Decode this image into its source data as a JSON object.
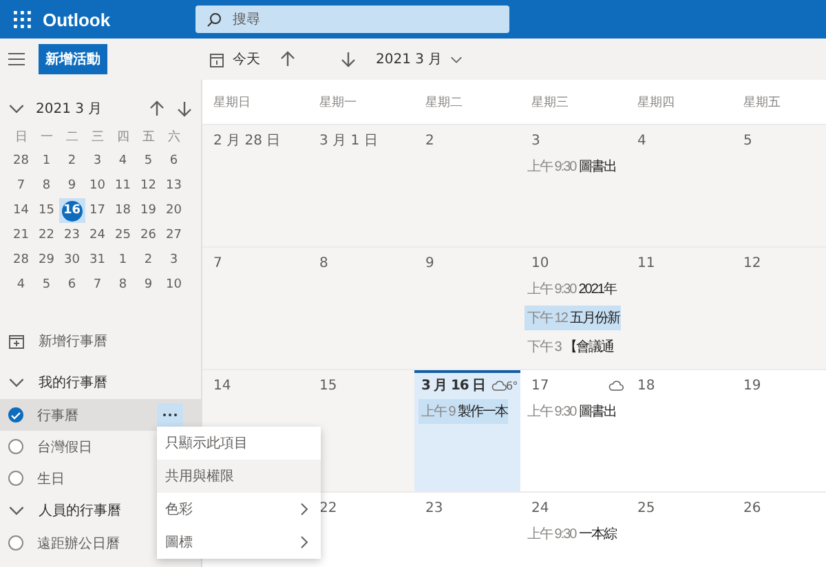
{
  "header": {
    "app_name": "Outlook",
    "search": {
      "placeholder": "搜尋"
    }
  },
  "toolbar": {
    "new_button": "新增活動",
    "today_button": "今天",
    "period": "2021 3 月"
  },
  "mini_calendar": {
    "title": "2021 3 月",
    "expanded": true,
    "weekdays": [
      "日",
      "一",
      "二",
      "三",
      "四",
      "五",
      "六"
    ],
    "weeks": [
      {
        "days": [
          {
            "label": "28",
            "selected": false
          },
          {
            "label": "1",
            "selected": false
          },
          {
            "label": "2",
            "selected": false
          },
          {
            "label": "3",
            "selected": false
          },
          {
            "label": "4",
            "selected": false
          },
          {
            "label": "5",
            "selected": false
          },
          {
            "label": "6",
            "selected": false
          }
        ]
      },
      {
        "days": [
          {
            "label": "7",
            "selected": false
          },
          {
            "label": "8",
            "selected": false
          },
          {
            "label": "9",
            "selected": false
          },
          {
            "label": "10",
            "selected": false
          },
          {
            "label": "11",
            "selected": false
          },
          {
            "label": "12",
            "selected": false
          },
          {
            "label": "13",
            "selected": false
          }
        ]
      },
      {
        "days": [
          {
            "label": "14",
            "selected": false
          },
          {
            "label": "15",
            "selected": false
          },
          {
            "label": "16",
            "selected": true
          },
          {
            "label": "17",
            "selected": false
          },
          {
            "label": "18",
            "selected": false
          },
          {
            "label": "19",
            "selected": false
          },
          {
            "label": "20",
            "selected": false
          }
        ]
      },
      {
        "days": [
          {
            "label": "21",
            "selected": false
          },
          {
            "label": "22",
            "selected": false
          },
          {
            "label": "23",
            "selected": false
          },
          {
            "label": "24",
            "selected": false
          },
          {
            "label": "25",
            "selected": false
          },
          {
            "label": "26",
            "selected": false
          },
          {
            "label": "27",
            "selected": false
          }
        ]
      },
      {
        "days": [
          {
            "label": "28",
            "selected": false
          },
          {
            "label": "29",
            "selected": false
          },
          {
            "label": "30",
            "selected": false
          },
          {
            "label": "31",
            "selected": false
          },
          {
            "label": "1",
            "selected": false
          },
          {
            "label": "2",
            "selected": false
          },
          {
            "label": "3",
            "selected": false
          }
        ]
      },
      {
        "days": [
          {
            "label": "4",
            "selected": false
          },
          {
            "label": "5",
            "selected": false
          },
          {
            "label": "6",
            "selected": false
          },
          {
            "label": "7",
            "selected": false
          },
          {
            "label": "8",
            "selected": false
          },
          {
            "label": "9",
            "selected": false
          },
          {
            "label": "10",
            "selected": false
          }
        ]
      }
    ]
  },
  "add_calendar": "新增行事曆",
  "calendar_groups": [
    {
      "name": "我的行事曆",
      "expanded": true,
      "calendars": [
        {
          "name": "行事曆",
          "checked": true,
          "highlighted": true
        },
        {
          "name": "台灣假日",
          "checked": false,
          "highlighted": false
        },
        {
          "name": "生日",
          "checked": false,
          "highlighted": false
        }
      ]
    },
    {
      "name": "人員的行事曆",
      "expanded": true,
      "calendars": [
        {
          "name": "遠距辦公日曆",
          "checked": false,
          "highlighted": false
        }
      ]
    }
  ],
  "context_menu": [
    {
      "label": "只顯示此項目",
      "submenu": false,
      "highlighted": false
    },
    {
      "label": "共用與權限",
      "submenu": false,
      "highlighted": true
    },
    {
      "label": "色彩",
      "submenu": true,
      "highlighted": false
    },
    {
      "label": "圖標",
      "submenu": true,
      "highlighted": false
    }
  ],
  "month_view": {
    "weekdays": [
      "星期日",
      "星期一",
      "星期二",
      "星期三",
      "星期四",
      "星期五"
    ],
    "weeks": [
      {
        "days": [
          {
            "label": "2 月 28 日",
            "past": true,
            "selected": false
          },
          {
            "label": "3 月 1 日",
            "past": true,
            "selected": false
          },
          {
            "label": "2",
            "past": true,
            "selected": false
          },
          {
            "label": "3",
            "past": true,
            "selected": false,
            "events": [
              {
                "time": "上午 9:30",
                "title": "圖書出",
                "highlighted": false
              }
            ]
          },
          {
            "label": "4",
            "past": true,
            "selected": false
          },
          {
            "label": "5",
            "past": true,
            "selected": false
          }
        ]
      },
      {
        "days": [
          {
            "label": "7",
            "past": true,
            "selected": false
          },
          {
            "label": "8",
            "past": true,
            "selected": false
          },
          {
            "label": "9",
            "past": true,
            "selected": false
          },
          {
            "label": "10",
            "past": true,
            "selected": false,
            "events": [
              {
                "time": "上午 9:30",
                "title": "2021年",
                "highlighted": false
              },
              {
                "time": "下午 12",
                "title": "五月份新",
                "highlighted": true
              },
              {
                "time": "下午 3",
                "title": "【會議通",
                "highlighted": false
              }
            ]
          },
          {
            "label": "11",
            "past": true,
            "selected": false
          },
          {
            "label": "12",
            "past": true,
            "selected": false
          }
        ]
      },
      {
        "days": [
          {
            "label": "14",
            "past": true,
            "selected": false
          },
          {
            "label": "15",
            "past": true,
            "selected": false
          },
          {
            "label": "3 月 16 日",
            "past": false,
            "selected": true,
            "weather": {
              "kind": "cloud",
              "temp": "6°"
            },
            "events": [
              {
                "time": "上午 9",
                "title": "製作一本",
                "highlighted": true
              }
            ]
          },
          {
            "label": "17",
            "past": false,
            "selected": false,
            "weather": {
              "kind": "cloud"
            },
            "events": [
              {
                "time": "上午 9:30",
                "title": "圖書出",
                "highlighted": false
              }
            ]
          },
          {
            "label": "18",
            "past": false,
            "selected": false
          },
          {
            "label": "19",
            "past": false,
            "selected": false
          }
        ]
      },
      {
        "days": [
          {
            "past": false,
            "selected": false
          },
          {
            "label": "22",
            "past": false,
            "selected": false
          },
          {
            "label": "23",
            "past": false,
            "selected": false
          },
          {
            "label": "24",
            "past": false,
            "selected": false,
            "events": [
              {
                "time": "上午 9:30",
                "title": "一本綜",
                "highlighted": false
              }
            ]
          },
          {
            "label": "25",
            "past": false,
            "selected": false
          },
          {
            "label": "26",
            "past": false,
            "selected": false
          }
        ]
      }
    ]
  }
}
